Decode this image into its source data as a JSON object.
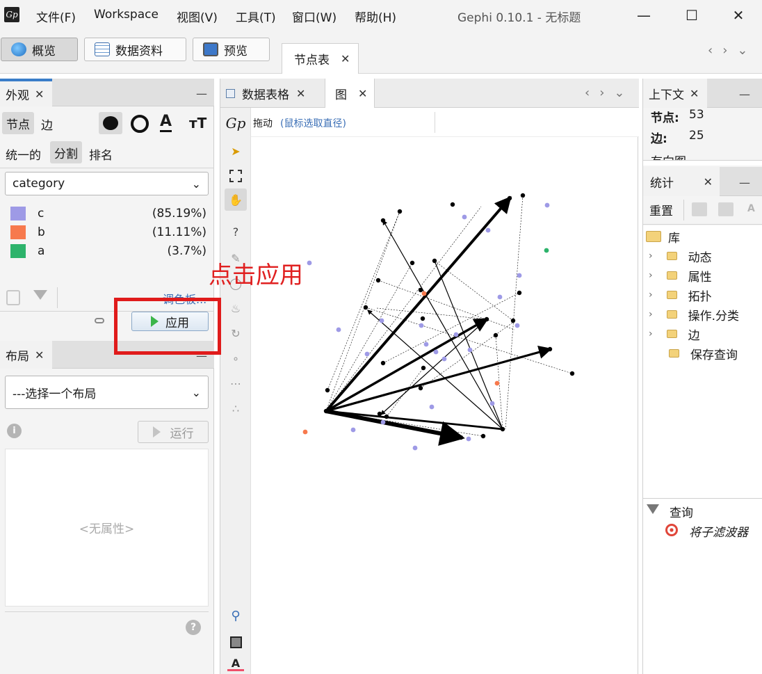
{
  "titlebar": {
    "logo_text": "Gp",
    "menu": [
      "文件(F)",
      "Workspace",
      "视图(V)",
      "工具(T)",
      "窗口(W)",
      "帮助(H)"
    ],
    "title": "Gephi 0.10.1 - 无标题"
  },
  "toolbar": {
    "overview": "概览",
    "data_lab": "数据资料",
    "preview": "预览",
    "node_table_tab": "节点表"
  },
  "appearance": {
    "tab": "外观",
    "nodes_tab": "节点",
    "edges_tab": "边",
    "mode_unique": "统一的",
    "mode_partition": "分割",
    "mode_ranking": "排名",
    "attribute": "category",
    "legend": [
      {
        "name": "c",
        "pct": "(85.19%)",
        "color": "#9e9ae6"
      },
      {
        "name": "b",
        "pct": "(11.11%)",
        "color": "#f7794d"
      },
      {
        "name": "a",
        "pct": "(3.7%)",
        "color": "#2db36b"
      }
    ],
    "palette_link": "调色板...",
    "apply_button": "应用"
  },
  "layout": {
    "tab": "布局",
    "select_placeholder": "---选择一个布局",
    "run_button": "运行",
    "no_properties": "<无属性>"
  },
  "graph": {
    "tab_data_table": "数据表格",
    "tab_graph": "图",
    "mode_label": "拖动",
    "mode_hint": "(鼠标选取直径)",
    "colors": {
      "c": "#9e9ae6",
      "b": "#f7794d",
      "a": "#2db36b",
      "black": "#000000"
    }
  },
  "context": {
    "tab": "上下文",
    "nodes_label": "节点:",
    "nodes_value": "53",
    "edges_label": "边:",
    "edges_value": "25",
    "directed_label": "有向图"
  },
  "statistics": {
    "tab": "统计",
    "reset": "重置",
    "library": "库",
    "tree": [
      "动态",
      "属性",
      "拓扑",
      "操作.分类",
      "边",
      "保存查询"
    ],
    "query": "查询",
    "filter_hint": "将子滤波器"
  },
  "annotation": {
    "text": "点击应用"
  }
}
